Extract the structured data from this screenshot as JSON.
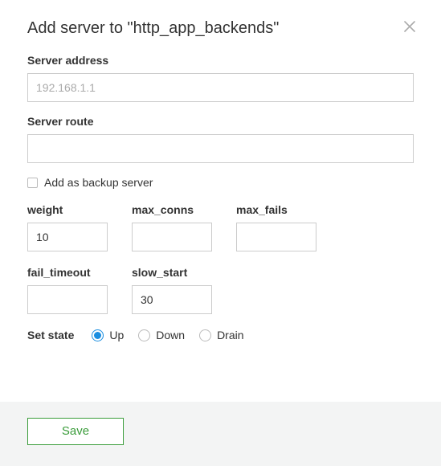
{
  "header": {
    "title": "Add server to \"http_app_backends\""
  },
  "form": {
    "address": {
      "label": "Server address",
      "placeholder": "192.168.1.1",
      "value": ""
    },
    "route": {
      "label": "Server route",
      "value": ""
    },
    "backup": {
      "label": "Add as backup server",
      "checked": false
    },
    "weight": {
      "label": "weight",
      "value": "10"
    },
    "max_conns": {
      "label": "max_conns",
      "value": ""
    },
    "max_fails": {
      "label": "max_fails",
      "value": ""
    },
    "fail_timeout": {
      "label": "fail_timeout",
      "value": ""
    },
    "slow_start": {
      "label": "slow_start",
      "value": "30"
    },
    "state": {
      "label": "Set state",
      "options": {
        "up": "Up",
        "down": "Down",
        "drain": "Drain"
      },
      "selected": "up"
    }
  },
  "footer": {
    "save_label": "Save"
  }
}
